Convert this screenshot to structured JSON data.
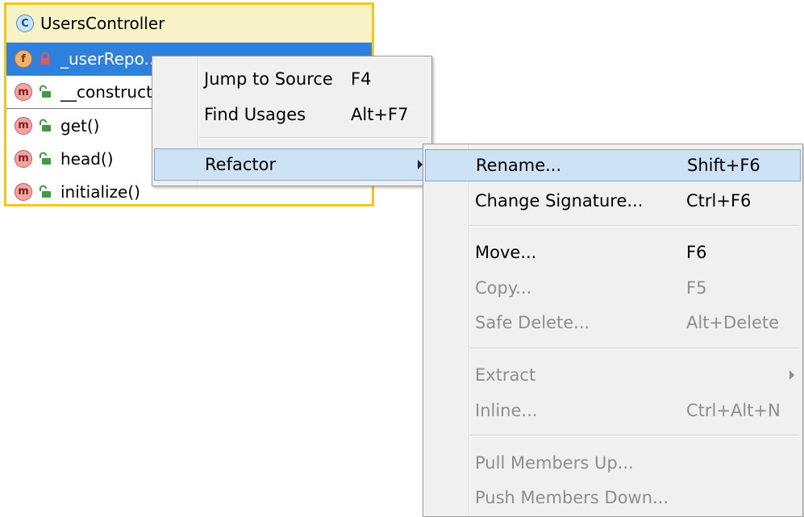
{
  "node": {
    "class_badge": "C",
    "class_name": "UsersController",
    "members": [
      {
        "badge": "f",
        "name": "_userRepo...",
        "visibility": "private",
        "selected": true
      },
      {
        "badge": "m",
        "name": "__construct()",
        "visibility": "public"
      },
      {
        "badge": "m",
        "name": "get()",
        "visibility": "public"
      },
      {
        "badge": "m",
        "name": "head()",
        "visibility": "public"
      },
      {
        "badge": "m",
        "name": "initialize()",
        "visibility": "public"
      }
    ]
  },
  "context_menu": {
    "items": [
      {
        "label": "Jump to Source",
        "shortcut": "F4"
      },
      {
        "label": "Find Usages",
        "shortcut": "Alt+F7"
      },
      {
        "label": "Refactor",
        "submenu": true
      }
    ]
  },
  "refactor_menu": {
    "items": [
      {
        "label": "Rename...",
        "shortcut": "Shift+F6",
        "enabled": true
      },
      {
        "label": "Change Signature...",
        "shortcut": "Ctrl+F6",
        "enabled": true
      },
      {
        "label": "Move...",
        "shortcut": "F6",
        "enabled": true
      },
      {
        "label": "Copy...",
        "shortcut": "F5",
        "enabled": false
      },
      {
        "label": "Safe Delete...",
        "shortcut": "Alt+Delete",
        "enabled": false
      },
      {
        "label": "Extract",
        "submenu": true,
        "enabled": false
      },
      {
        "label": "Inline...",
        "shortcut": "Ctrl+Alt+N",
        "enabled": false
      },
      {
        "label": "Pull Members Up...",
        "enabled": false
      },
      {
        "label": "Push Members Down...",
        "enabled": false
      }
    ]
  },
  "colors": {
    "node_border": "#f5c518",
    "header_bg": "#f7f3c6",
    "selection": "#2f7fdc",
    "menu_bg": "#f0f0f0",
    "menu_highlight": "#cde2f5",
    "disabled_text": "#8e8e8e"
  },
  "icons": {
    "class": "class-badge-icon",
    "field": "field-badge-icon",
    "method": "method-badge-icon",
    "private": "lock-closed-icon",
    "public": "lock-open-icon",
    "submenu": "submenu-arrow-icon"
  }
}
